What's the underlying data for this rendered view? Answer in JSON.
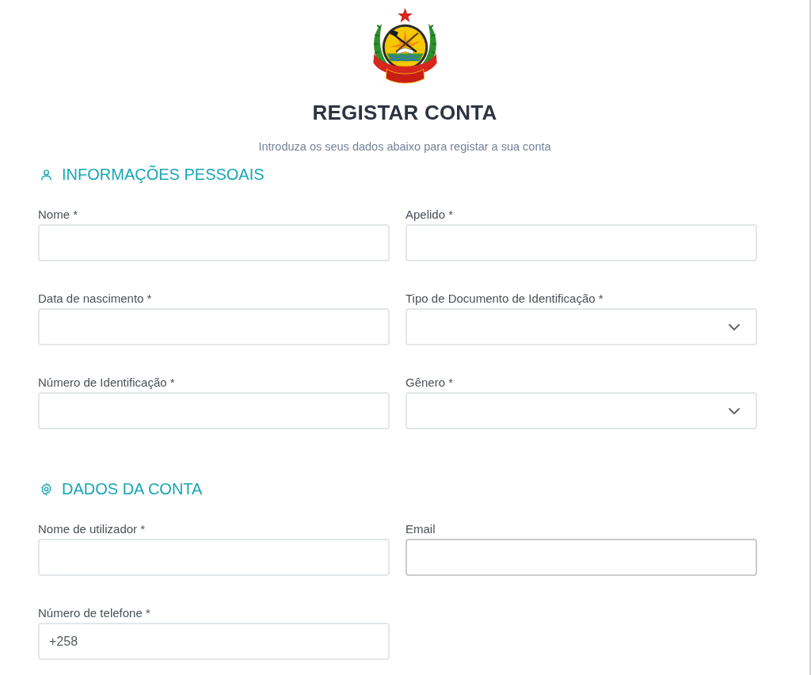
{
  "header": {
    "title": "REGISTAR CONTA",
    "subtitle": "Introduza os seus dados abaixo para registar a sua conta"
  },
  "sections": [
    {
      "kind": "personal",
      "title": "INFORMAÇÕES PESSOAIS",
      "fields": [
        {
          "label": "Nome *",
          "kind": "text",
          "focused": false
        },
        {
          "label": "Apelido *",
          "kind": "text",
          "focused": false
        },
        {
          "label": "Data de nascimento *",
          "kind": "text",
          "focused": false
        },
        {
          "label": "Tipo de Documento de Identificação *",
          "kind": "select",
          "focused": false
        },
        {
          "label": "Número de Identificação *",
          "kind": "text",
          "focused": false
        },
        {
          "label": "Gênero *",
          "kind": "select",
          "focused": false
        }
      ]
    },
    {
      "kind": "account",
      "title": "DADOS DA CONTA",
      "fields": [
        {
          "label": "Nome de utilizador *",
          "kind": "text",
          "focused": false
        },
        {
          "label": "Email",
          "kind": "text",
          "focused": true
        },
        {
          "label": "Número de telefone *",
          "kind": "text",
          "focused": false,
          "value": "+258"
        }
      ]
    }
  ]
}
